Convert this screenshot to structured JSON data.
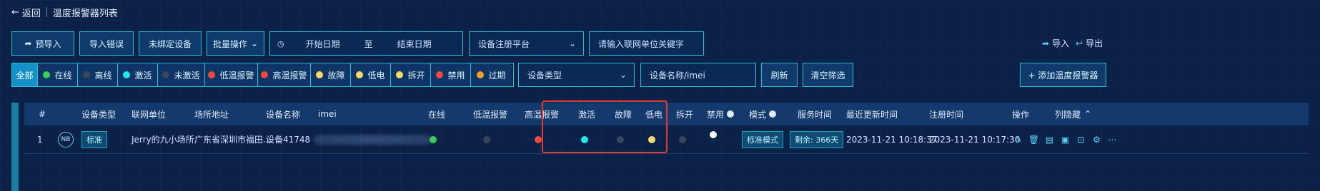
{
  "header": {
    "back_label": "返回",
    "title": "温度报警器列表"
  },
  "toolbar": {
    "pre_import": "预导入",
    "import_errors": "导入错误",
    "unbound": "未绑定设备",
    "batch": "批量操作",
    "start_date": "开始日期",
    "date_to": "至",
    "end_date": "结束日期",
    "platform_placeholder": "设备注册平台",
    "org_placeholder": "请输入联网单位关键字",
    "import": "导入",
    "export": "导出"
  },
  "filters": {
    "items": [
      {
        "label": "全部",
        "color": ""
      },
      {
        "label": "在线",
        "color": "#34d058"
      },
      {
        "label": "离线",
        "color": "#3a4558"
      },
      {
        "label": "激活",
        "color": "#21e6f0"
      },
      {
        "label": "未激活",
        "color": "#3a4558"
      },
      {
        "label": "低温报警",
        "color": "#ef4a3c"
      },
      {
        "label": "高温报警",
        "color": "#ef4a3c"
      },
      {
        "label": "故障",
        "color": "#f5dc6a"
      },
      {
        "label": "低电",
        "color": "#f5dc6a"
      },
      {
        "label": "拆开",
        "color": "#f5dc6a"
      },
      {
        "label": "禁用",
        "color": "#ef4a3c"
      },
      {
        "label": "过期",
        "color": "#f5a023"
      }
    ],
    "device_type_placeholder": "设备类型",
    "device_name_placeholder": "设备名称/imei",
    "refresh": "刷新",
    "clear": "清空筛选",
    "add": "+ 添加温度报警器"
  },
  "table": {
    "headers": {
      "index": "#",
      "type": "设备类型",
      "org": "联网单位",
      "address": "场所地址",
      "name": "设备名称",
      "imei": "imei",
      "online": "在线",
      "low_temp": "低温报警",
      "high_temp": "高温报警",
      "activated": "激活",
      "fault": "故障",
      "low_battery": "低电",
      "opened": "拆开",
      "disabled": "禁用",
      "mode": "模式",
      "service": "服务时间",
      "updated": "最近更新时间",
      "registered": "注册时间",
      "ops": "操作",
      "hide_cols": "列隐藏"
    },
    "rows": [
      {
        "index": "1",
        "badge": "NB",
        "type": "标准",
        "org": "Jerry的九小场所",
        "address": "广东省深圳市福田...",
        "name": "设备41748",
        "online": "#34d058",
        "low_temp": "#3a4558",
        "high_temp": "#ef4a3c",
        "activated": "#21e6f0",
        "fault": "#3a4558",
        "low_battery": "#f5dc6a",
        "opened": "#3a4558",
        "disabled": "#ffffff",
        "mode": "标准模式",
        "service": "剩余: 366天",
        "updated": "2023-11-21 10:18:37",
        "registered": "2023-11-21 10:17:30"
      }
    ]
  }
}
